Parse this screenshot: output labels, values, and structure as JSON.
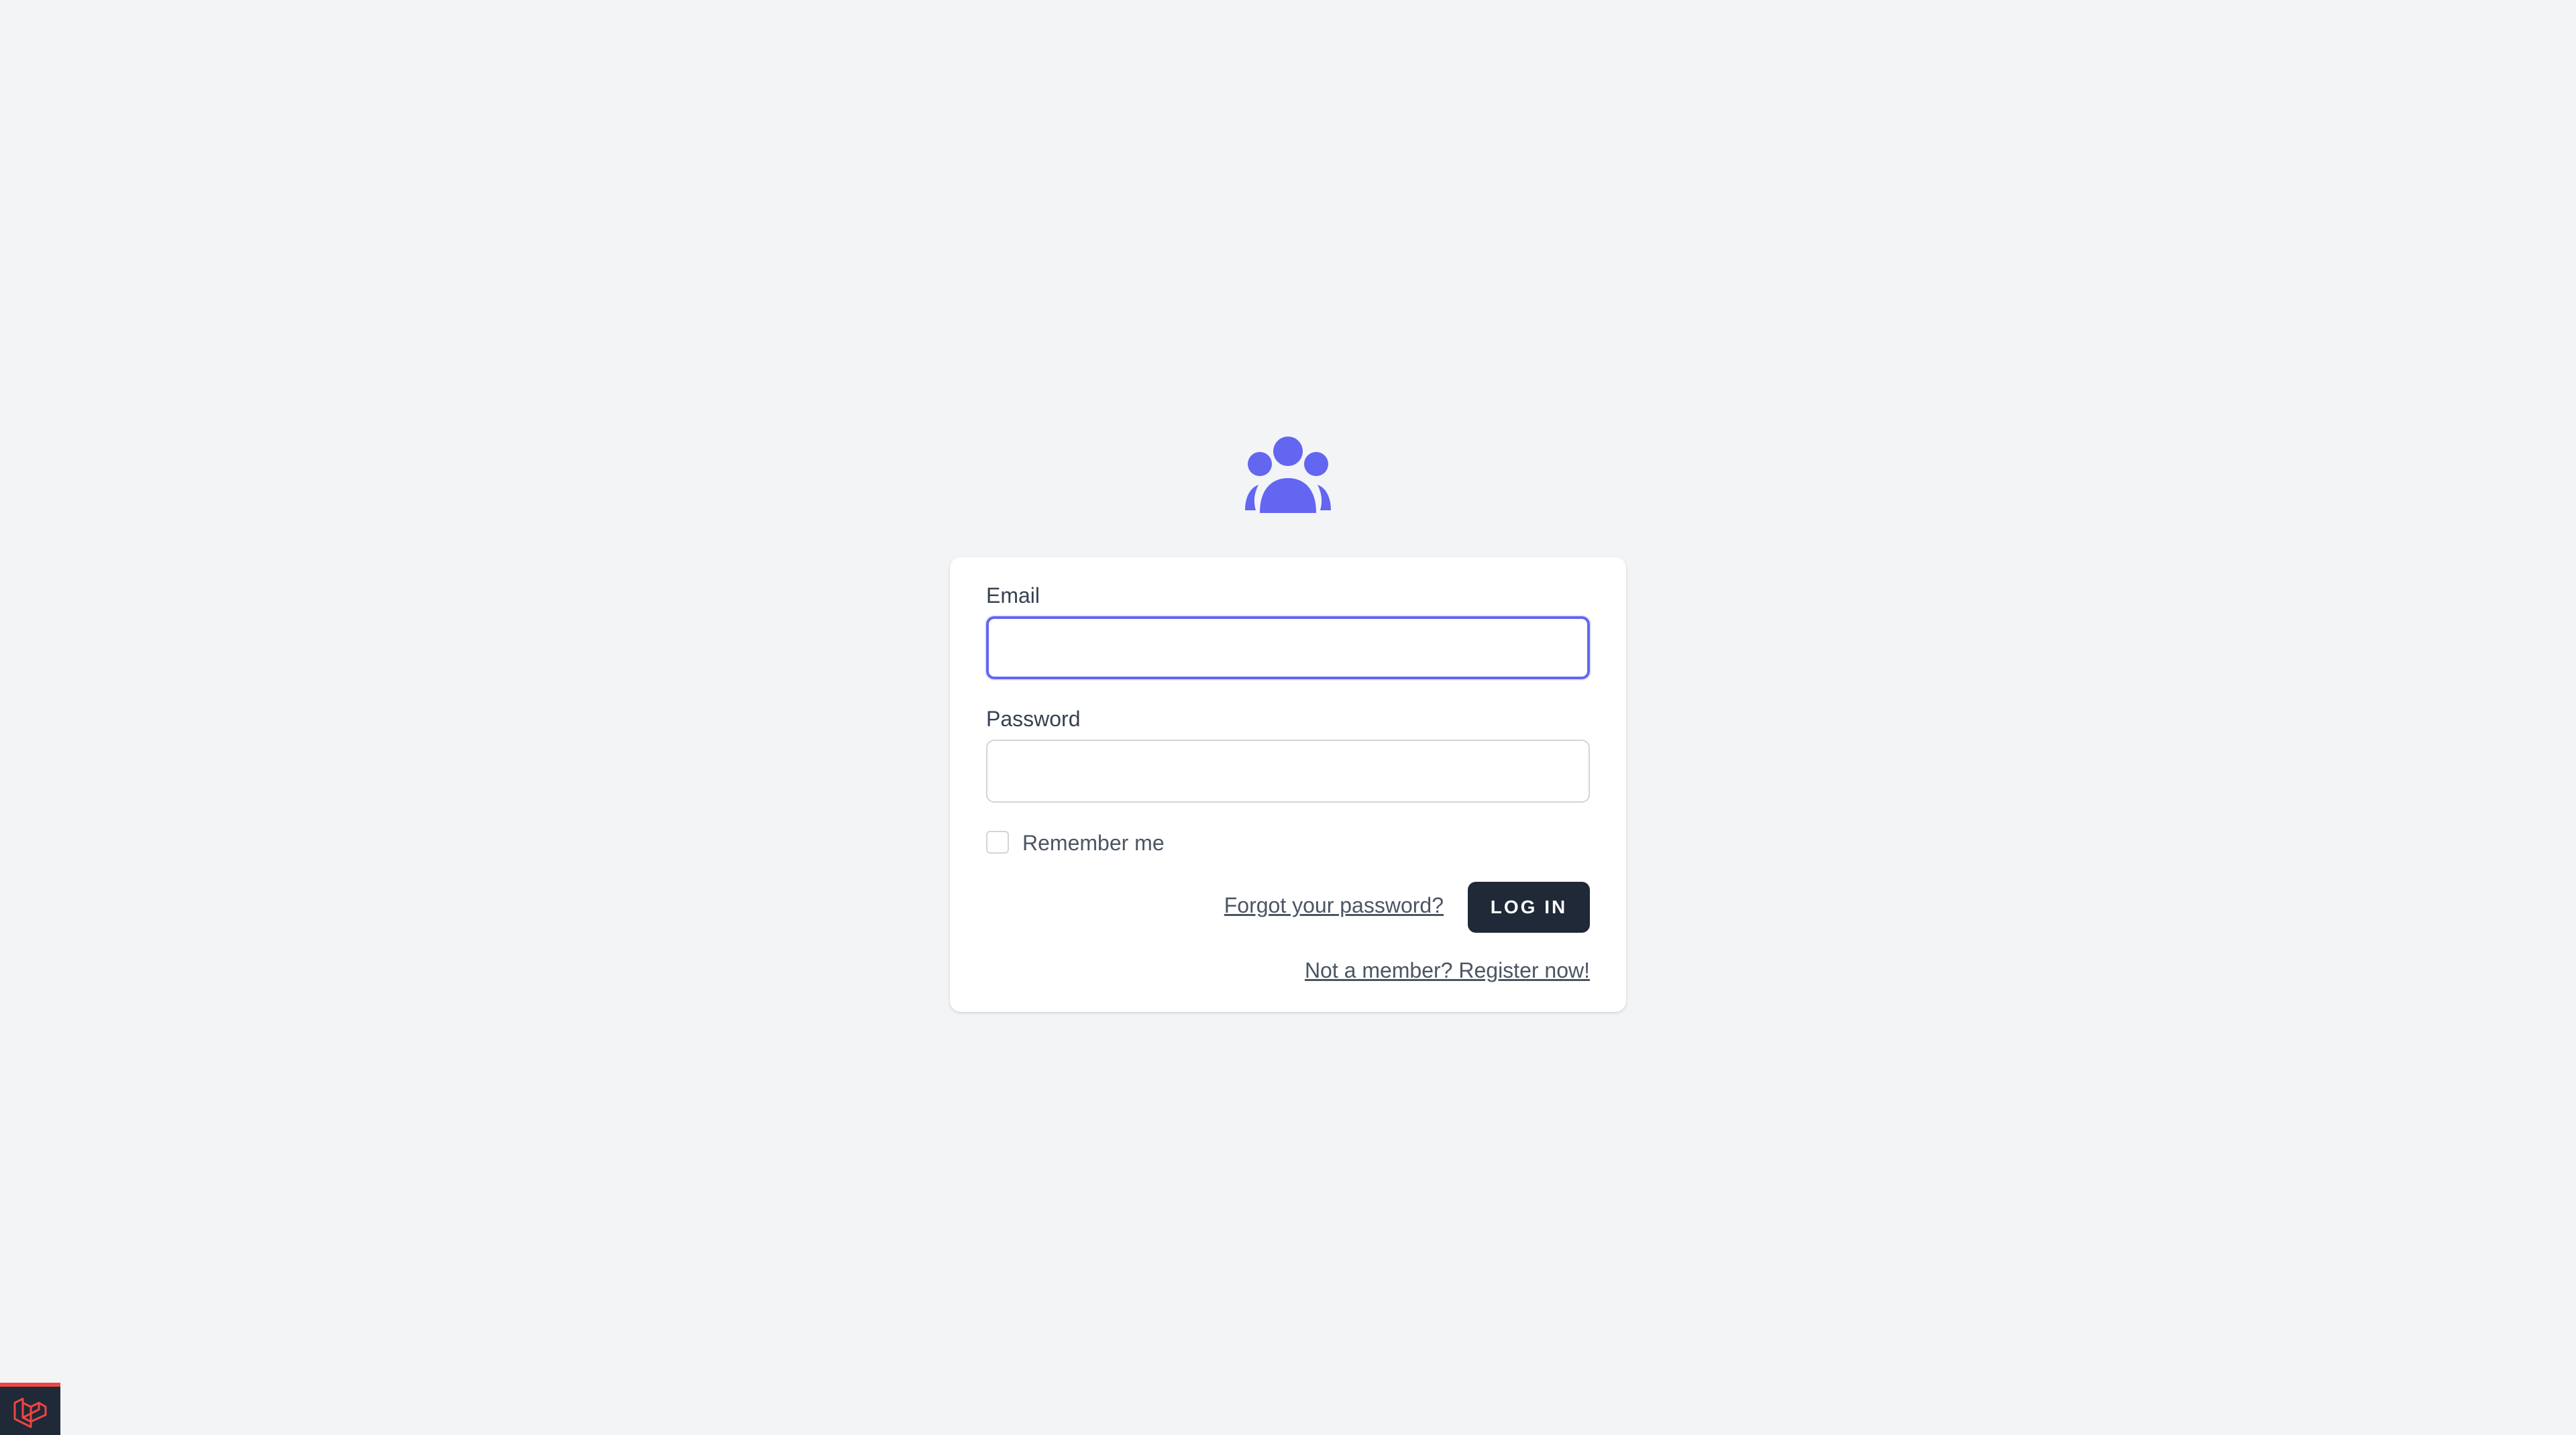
{
  "brand": {
    "logo_icon": "users-group-icon",
    "accent_color": "#6366f1"
  },
  "login_form": {
    "email_label": "Email",
    "email_value": "",
    "password_label": "Password",
    "password_value": "",
    "remember_label": "Remember me",
    "remember_checked": false,
    "forgot_link": "Forgot your password?",
    "login_button": "LOG IN",
    "register_link": "Not a member? Register now!"
  },
  "debugbar": {
    "icon": "laravel-icon",
    "accent_color": "#ef4444"
  }
}
